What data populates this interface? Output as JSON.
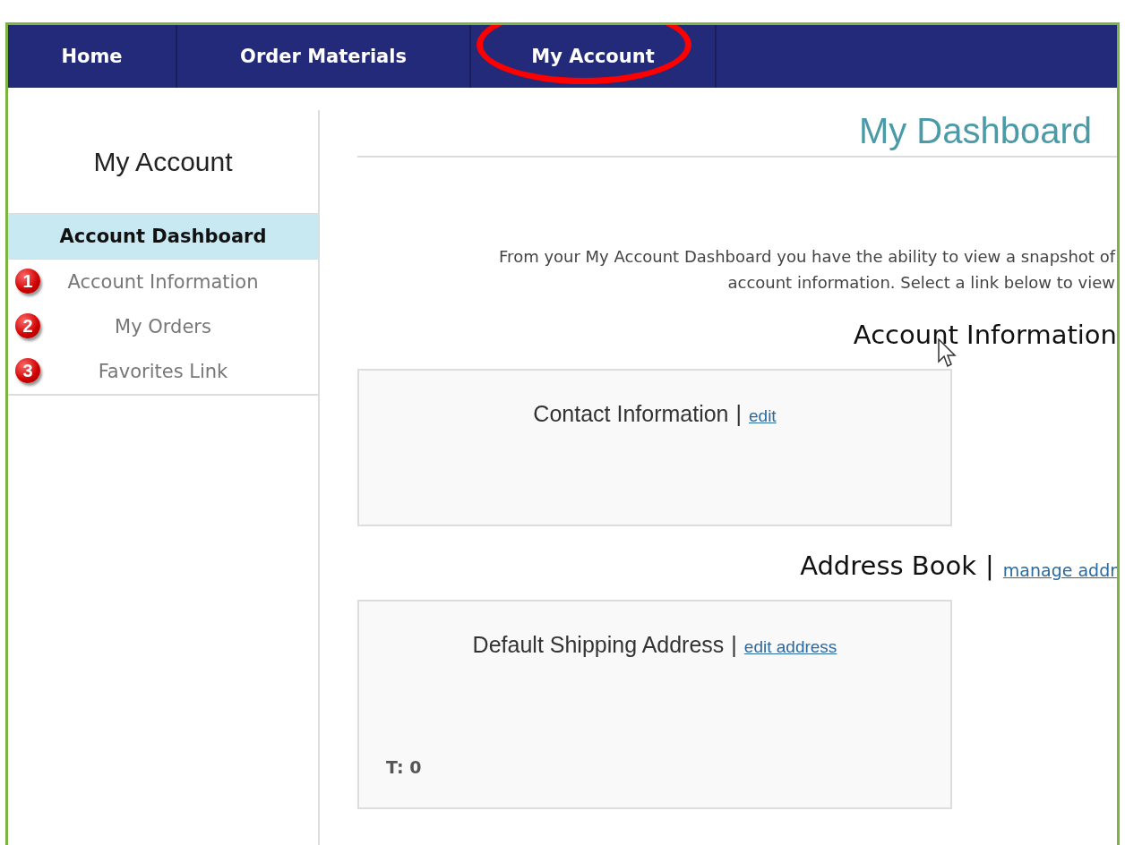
{
  "nav": {
    "tabs": [
      {
        "label": "Home",
        "circled": false
      },
      {
        "label": "Order Materials",
        "circled": false
      },
      {
        "label": "My Account",
        "circled": true
      }
    ]
  },
  "sidebar": {
    "title": "My Account",
    "items": [
      {
        "label": "Account Dashboard",
        "selected": true
      },
      {
        "label": "Account Information",
        "selected": false,
        "badge": "1"
      },
      {
        "label": "My Orders",
        "selected": false,
        "badge": "2"
      },
      {
        "label": "Favorites Link",
        "selected": false,
        "badge": "3"
      }
    ]
  },
  "main": {
    "title": "My Dashboard",
    "intro": [
      "From your My Account Dashboard you have the ability to view a snapshot of",
      "account information. Select a link below to view"
    ],
    "sections": [
      {
        "heading": "Account Information",
        "card": {
          "title": "Contact Information",
          "separator": "|",
          "link": "edit"
        }
      },
      {
        "heading": "Address Book",
        "separator": "|",
        "link": "manage addr",
        "card": {
          "title": "Default Shipping Address",
          "separator": "|",
          "link": "edit address",
          "footer": "T: 0"
        }
      }
    ]
  }
}
